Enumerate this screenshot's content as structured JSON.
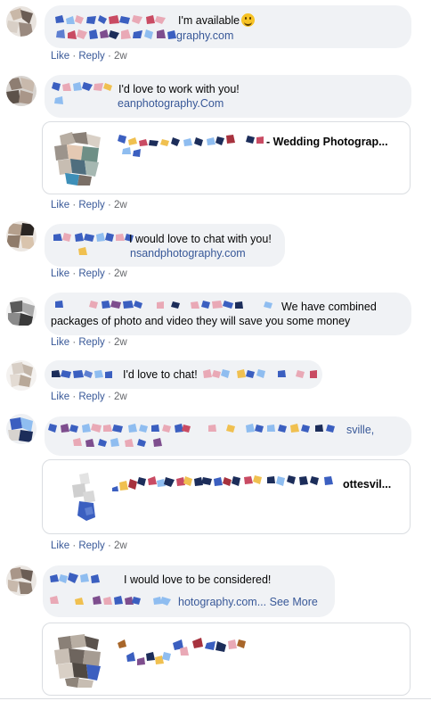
{
  "actions": {
    "like": "Like",
    "reply": "Reply",
    "sep": "·"
  },
  "comments": [
    {
      "text": "I'm available",
      "link": "graphy.com",
      "time": "2w"
    },
    {
      "text": "I'd love to work with you!",
      "link": "eanphotography.Com",
      "card_title": "- Wedding Photograp...",
      "time": "2w"
    },
    {
      "text": "I would love to chat with you!",
      "link": "nsandphotography.com",
      "time": "2w"
    },
    {
      "text": "We have combined",
      "text2": "packages of photo and video they will save you some money",
      "time": "2w"
    },
    {
      "text": "I'd love to chat!",
      "time": "2w"
    },
    {
      "text": "sville,",
      "card_title": "ottesvil...",
      "time": "2w"
    },
    {
      "text": "I would love to be considered!",
      "link": "hotography.com...",
      "see_more": "See More"
    }
  ],
  "colors": {
    "link": "#385898",
    "meta": "#65676b",
    "bubble": "#f0f2f5"
  }
}
